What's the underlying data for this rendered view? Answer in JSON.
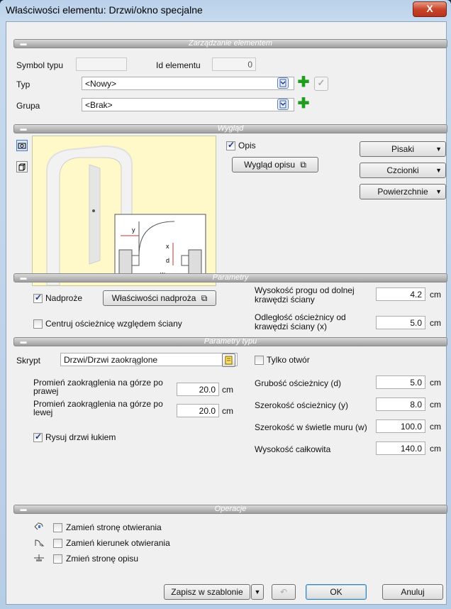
{
  "window": {
    "title": "Właściwości elementu: Drzwi/okno specjalne",
    "close_glyph": "X"
  },
  "sections": {
    "management": "Zarządzanie elementem",
    "appearance": "Wygląd",
    "parameters": "Parametry",
    "type_parameters": "Parametry typu",
    "operations": "Operacje"
  },
  "management": {
    "symbol_label": "Symbol typu",
    "symbol_value": "",
    "id_label": "Id elementu",
    "id_value": "0",
    "type_label": "Typ",
    "type_value": "<Nowy>",
    "group_label": "Grupa",
    "group_value": "<Brak>"
  },
  "appearance": {
    "description_checkbox": "Opis",
    "description_checked": true,
    "description_look_button": "Wygląd opisu",
    "pens_button": "Pisaki",
    "fonts_button": "Czcionki",
    "surfaces_button": "Powierzchnie",
    "diagram_labels": {
      "y": "y",
      "x": "x",
      "d": "d",
      "w": "w"
    }
  },
  "parameters": {
    "lintel_checkbox": "Nadproże",
    "lintel_checked": true,
    "lintel_props_button": "Właściwości nadproża",
    "center_frame_checkbox": "Centruj ościeżnicę względem ściany",
    "center_frame_checked": false,
    "threshold_label": "Wysokość progu od dolnej krawędzi ściany",
    "threshold_value": "4.2",
    "frame_distance_label": "Odległość ościeżnicy od krawędzi ściany (x)",
    "frame_distance_value": "5.0",
    "unit": "cm"
  },
  "type_parameters": {
    "script_label": "Skrypt",
    "script_value": "Drzwi/Drzwi zaokrąglone",
    "radius_right_label": "Promień zaokrąglenia na górze po prawej",
    "radius_right_value": "20.0",
    "radius_left_label": "Promień zaokrąglenia na górze po lewej",
    "radius_left_value": "20.0",
    "draw_arc_checkbox": "Rysuj drzwi łukiem",
    "draw_arc_checked": true,
    "opening_only_checkbox": "Tylko otwór",
    "opening_only_checked": false,
    "frame_thickness_label": "Grubość ościeżnicy (d)",
    "frame_thickness_value": "5.0",
    "frame_width_label": "Szerokość ościeżnicy (y)",
    "frame_width_value": "8.0",
    "clear_width_label": "Szerokość w świetle muru (w)",
    "clear_width_value": "100.0",
    "total_height_label": "Wysokość całkowita",
    "total_height_value": "140.0",
    "unit": "cm"
  },
  "operations": {
    "swap_side": "Zamień stronę otwierania",
    "swap_direction": "Zamień kierunek otwierania",
    "change_description_side": "Zmień stronę opisu"
  },
  "footer": {
    "save_template": "Zapisz w szablonie",
    "ok": "OK",
    "cancel": "Anuluj"
  },
  "colors": {
    "section_header": "#a5a5a5",
    "preview_bg": "#fff9c9",
    "accent": "#1e9d1e"
  }
}
